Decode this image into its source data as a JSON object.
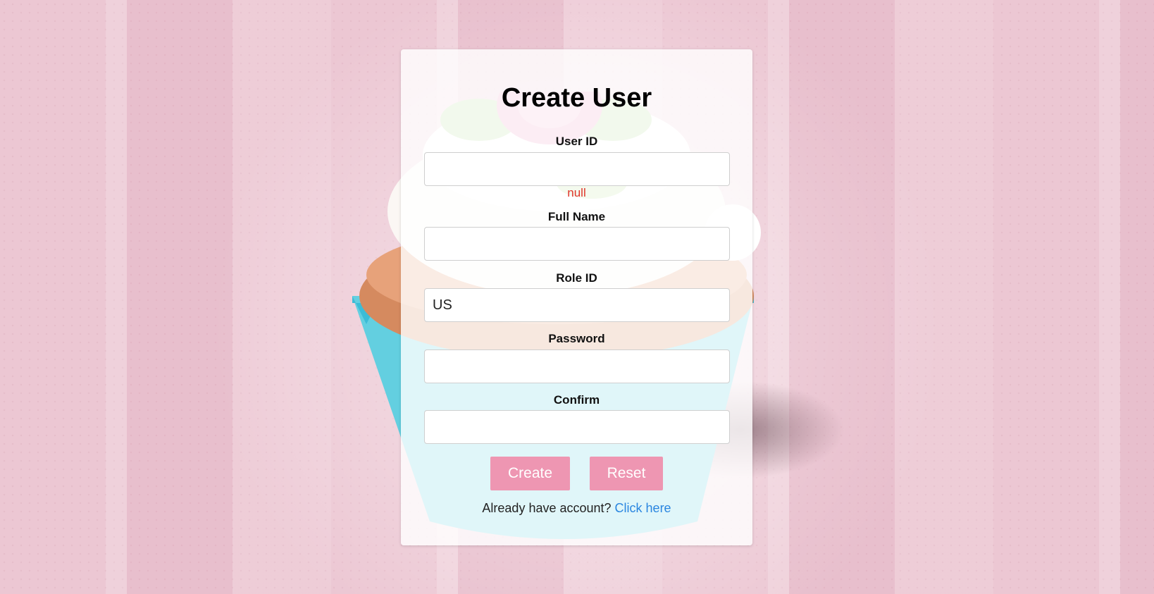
{
  "form": {
    "title": "Create User",
    "user_id": {
      "label": "User ID",
      "value": "",
      "error": "null"
    },
    "full_name": {
      "label": "Full Name",
      "value": ""
    },
    "role_id": {
      "label": "Role ID",
      "value": "US"
    },
    "password": {
      "label": "Password",
      "value": ""
    },
    "confirm": {
      "label": "Confirm",
      "value": ""
    },
    "create_label": "Create",
    "reset_label": "Reset",
    "footer_text": "Already have account?",
    "footer_link": "Click here"
  },
  "colors": {
    "accent": "#ee96b2",
    "error": "#e0352b",
    "link": "#2a86e0"
  }
}
